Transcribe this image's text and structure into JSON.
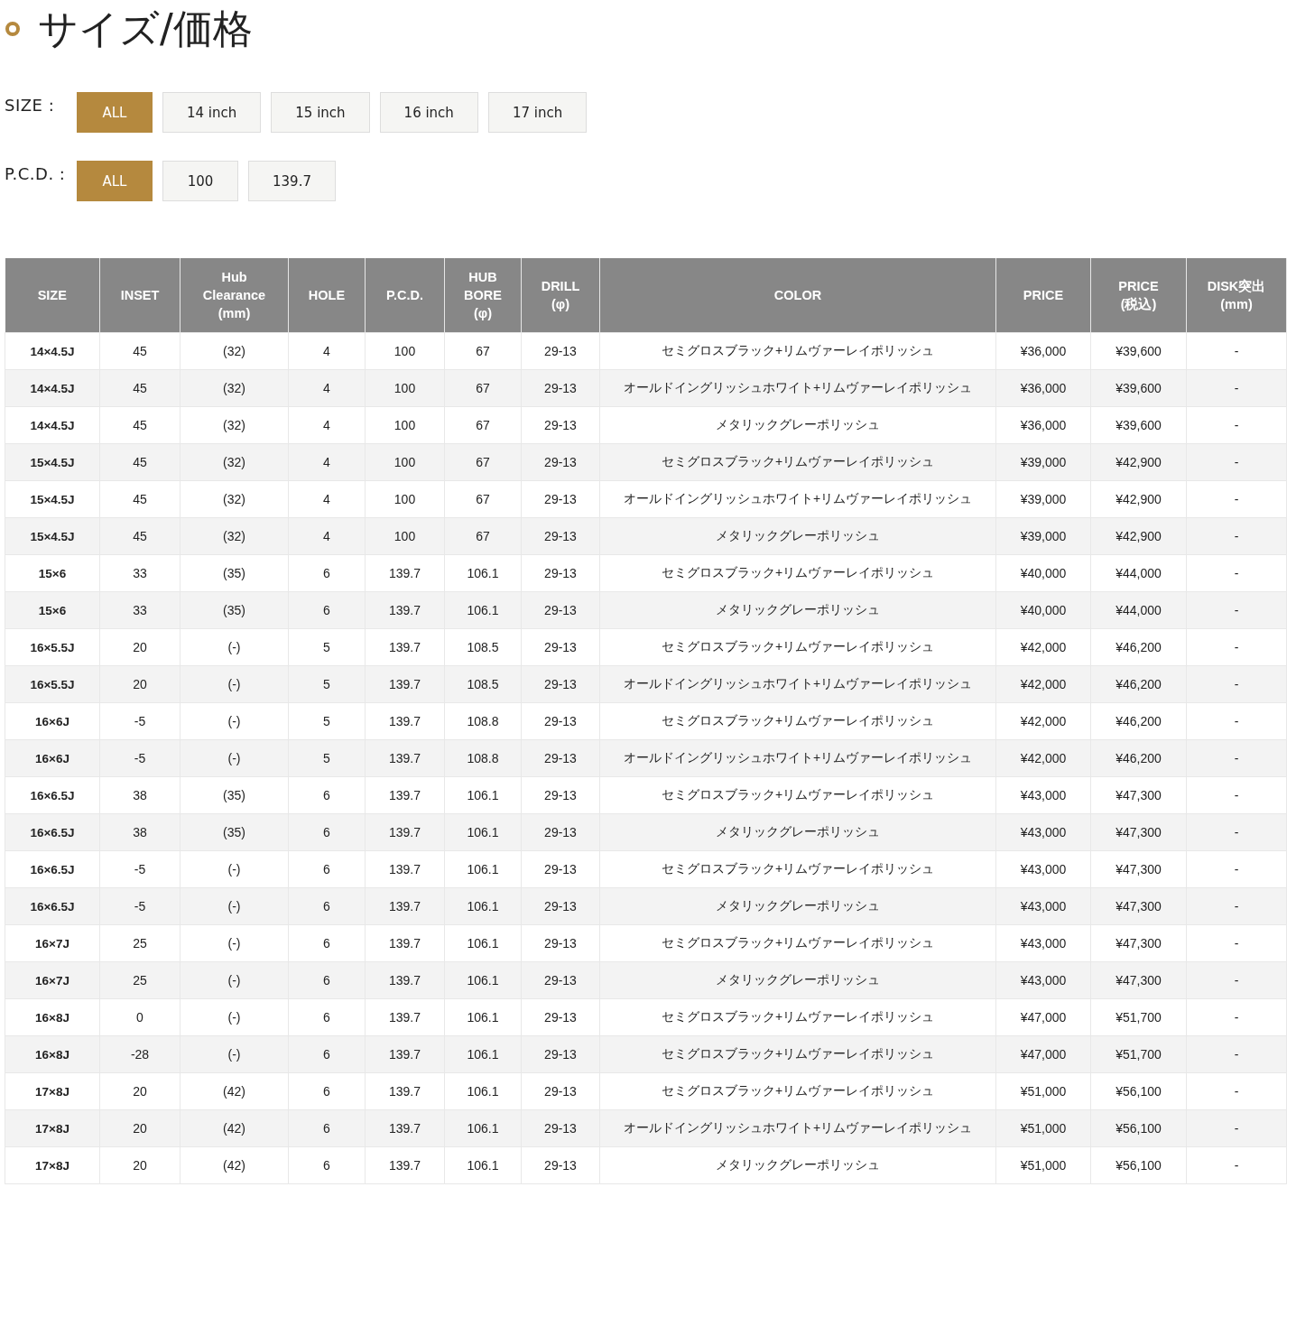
{
  "title": "サイズ/価格",
  "filters": [
    {
      "label": "SIZE :",
      "options": [
        {
          "label": "ALL",
          "selected": true
        },
        {
          "label": "14 inch",
          "selected": false
        },
        {
          "label": "15 inch",
          "selected": false
        },
        {
          "label": "16 inch",
          "selected": false
        },
        {
          "label": "17 inch",
          "selected": false
        }
      ]
    },
    {
      "label": "P.C.D. :",
      "options": [
        {
          "label": "ALL",
          "selected": true
        },
        {
          "label": "100",
          "selected": false
        },
        {
          "label": "139.7",
          "selected": false
        }
      ]
    }
  ],
  "table": {
    "columns": [
      "SIZE",
      "INSET",
      "Hub\nClearance\n(mm)",
      "HOLE",
      "P.C.D.",
      "HUB\nBORE\n(φ)",
      "DRILL\n(φ)",
      "COLOR",
      "PRICE",
      "PRICE\n(税込)",
      "DISK突出\n(mm)"
    ],
    "rows": [
      [
        "14×4.5J",
        "45",
        "(32)",
        "4",
        "100",
        "67",
        "29-13",
        "セミグロスブラック+リムヴァーレイポリッシュ",
        "¥36,000",
        "¥39,600",
        "-"
      ],
      [
        "14×4.5J",
        "45",
        "(32)",
        "4",
        "100",
        "67",
        "29-13",
        "オールドイングリッシュホワイト+リムヴァーレイポリッシュ",
        "¥36,000",
        "¥39,600",
        "-"
      ],
      [
        "14×4.5J",
        "45",
        "(32)",
        "4",
        "100",
        "67",
        "29-13",
        "メタリックグレーポリッシュ",
        "¥36,000",
        "¥39,600",
        "-"
      ],
      [
        "15×4.5J",
        "45",
        "(32)",
        "4",
        "100",
        "67",
        "29-13",
        "セミグロスブラック+リムヴァーレイポリッシュ",
        "¥39,000",
        "¥42,900",
        "-"
      ],
      [
        "15×4.5J",
        "45",
        "(32)",
        "4",
        "100",
        "67",
        "29-13",
        "オールドイングリッシュホワイト+リムヴァーレイポリッシュ",
        "¥39,000",
        "¥42,900",
        "-"
      ],
      [
        "15×4.5J",
        "45",
        "(32)",
        "4",
        "100",
        "67",
        "29-13",
        "メタリックグレーポリッシュ",
        "¥39,000",
        "¥42,900",
        "-"
      ],
      [
        "15×6",
        "33",
        "(35)",
        "6",
        "139.7",
        "106.1",
        "29-13",
        "セミグロスブラック+リムヴァーレイポリッシュ",
        "¥40,000",
        "¥44,000",
        "-"
      ],
      [
        "15×6",
        "33",
        "(35)",
        "6",
        "139.7",
        "106.1",
        "29-13",
        "メタリックグレーポリッシュ",
        "¥40,000",
        "¥44,000",
        "-"
      ],
      [
        "16×5.5J",
        "20",
        "(-)",
        "5",
        "139.7",
        "108.5",
        "29-13",
        "セミグロスブラック+リムヴァーレイポリッシュ",
        "¥42,000",
        "¥46,200",
        "-"
      ],
      [
        "16×5.5J",
        "20",
        "(-)",
        "5",
        "139.7",
        "108.5",
        "29-13",
        "オールドイングリッシュホワイト+リムヴァーレイポリッシュ",
        "¥42,000",
        "¥46,200",
        "-"
      ],
      [
        "16×6J",
        "-5",
        "(-)",
        "5",
        "139.7",
        "108.8",
        "29-13",
        "セミグロスブラック+リムヴァーレイポリッシュ",
        "¥42,000",
        "¥46,200",
        "-"
      ],
      [
        "16×6J",
        "-5",
        "(-)",
        "5",
        "139.7",
        "108.8",
        "29-13",
        "オールドイングリッシュホワイト+リムヴァーレイポリッシュ",
        "¥42,000",
        "¥46,200",
        "-"
      ],
      [
        "16×6.5J",
        "38",
        "(35)",
        "6",
        "139.7",
        "106.1",
        "29-13",
        "セミグロスブラック+リムヴァーレイポリッシュ",
        "¥43,000",
        "¥47,300",
        "-"
      ],
      [
        "16×6.5J",
        "38",
        "(35)",
        "6",
        "139.7",
        "106.1",
        "29-13",
        "メタリックグレーポリッシュ",
        "¥43,000",
        "¥47,300",
        "-"
      ],
      [
        "16×6.5J",
        "-5",
        "(-)",
        "6",
        "139.7",
        "106.1",
        "29-13",
        "セミグロスブラック+リムヴァーレイポリッシュ",
        "¥43,000",
        "¥47,300",
        "-"
      ],
      [
        "16×6.5J",
        "-5",
        "(-)",
        "6",
        "139.7",
        "106.1",
        "29-13",
        "メタリックグレーポリッシュ",
        "¥43,000",
        "¥47,300",
        "-"
      ],
      [
        "16×7J",
        "25",
        "(-)",
        "6",
        "139.7",
        "106.1",
        "29-13",
        "セミグロスブラック+リムヴァーレイポリッシュ",
        "¥43,000",
        "¥47,300",
        "-"
      ],
      [
        "16×7J",
        "25",
        "(-)",
        "6",
        "139.7",
        "106.1",
        "29-13",
        "メタリックグレーポリッシュ",
        "¥43,000",
        "¥47,300",
        "-"
      ],
      [
        "16×8J",
        "0",
        "(-)",
        "6",
        "139.7",
        "106.1",
        "29-13",
        "セミグロスブラック+リムヴァーレイポリッシュ",
        "¥47,000",
        "¥51,700",
        "-"
      ],
      [
        "16×8J",
        "-28",
        "(-)",
        "6",
        "139.7",
        "106.1",
        "29-13",
        "セミグロスブラック+リムヴァーレイポリッシュ",
        "¥47,000",
        "¥51,700",
        "-"
      ],
      [
        "17×8J",
        "20",
        "(42)",
        "6",
        "139.7",
        "106.1",
        "29-13",
        "セミグロスブラック+リムヴァーレイポリッシュ",
        "¥51,000",
        "¥56,100",
        "-"
      ],
      [
        "17×8J",
        "20",
        "(42)",
        "6",
        "139.7",
        "106.1",
        "29-13",
        "オールドイングリッシュホワイト+リムヴァーレイポリッシュ",
        "¥51,000",
        "¥56,100",
        "-"
      ],
      [
        "17×8J",
        "20",
        "(42)",
        "6",
        "139.7",
        "106.1",
        "29-13",
        "メタリックグレーポリッシュ",
        "¥51,000",
        "¥56,100",
        "-"
      ]
    ]
  }
}
